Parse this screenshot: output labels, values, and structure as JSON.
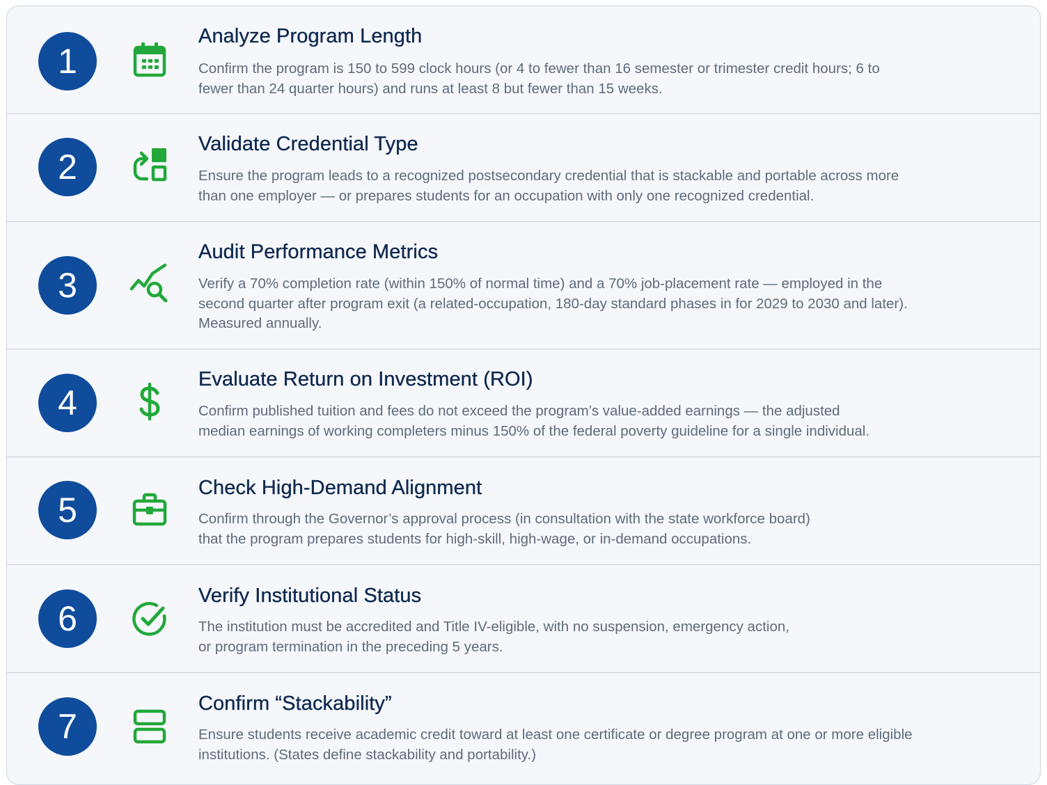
{
  "colors": {
    "number_bg": "#0f4c9c",
    "icon": "#22a83a",
    "title": "#10294f",
    "text": "#5f6b7a",
    "card_bg": "#f5f7fb",
    "divider": "#c9d0da"
  },
  "steps": [
    {
      "number": "1",
      "icon": "calendar-icon",
      "title": "Analyze Program Length",
      "description": "Confirm the program is 150 to 599 clock hours (or 4 to fewer than 16 semester or trimester credit hours; 6 to\nfewer than 24 quarter hours) and runs at least 8 but fewer than 15 weeks."
    },
    {
      "number": "2",
      "icon": "stack-arrow-icon",
      "title": "Validate Credential Type",
      "description": "Ensure the program leads to a recognized postsecondary credential that is stackable and portable across more\nthan one employer — or prepares students for an occupation with only one recognized credential."
    },
    {
      "number": "3",
      "icon": "chart-search-icon",
      "title": "Audit Performance Metrics",
      "description": "Verify a 70% completion rate (within 150% of normal time) and a 70% job-placement rate — employed in the\nsecond quarter after program exit (a related-occupation, 180-day standard phases in for 2029 to 2030 and later).\nMeasured annually."
    },
    {
      "number": "4",
      "icon": "dollar-icon",
      "title": "Evaluate Return on Investment (ROI)",
      "description": "Confirm published tuition and fees do not exceed the program’s value-added earnings — the adjusted\nmedian earnings of working completers minus 150% of the federal poverty guideline for a single individual."
    },
    {
      "number": "5",
      "icon": "briefcase-icon",
      "title": "Check High-Demand Alignment",
      "description": "Confirm through the Governor’s approval process (in consultation with the state workforce board)\nthat the program prepares students for high-skill, high-wage, or in-demand occupations."
    },
    {
      "number": "6",
      "icon": "check-circle-icon",
      "title": "Verify Institutional Status",
      "description": "The institution must be accredited and Title IV-eligible, with no suspension, emergency action,\nor program termination in the preceding 5 years."
    },
    {
      "number": "7",
      "icon": "stacked-rows-icon",
      "title": "Confirm “Stackability”",
      "description": "Ensure students receive academic credit toward at least one certificate or degree program at one or more eligible\ninstitutions. (States define stackability and portability.)"
    }
  ]
}
